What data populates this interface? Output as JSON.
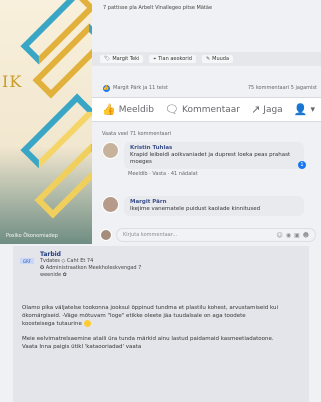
{
  "art": {
    "logo_text": "IK",
    "caption": "Poslko Ökonomiadep"
  },
  "top_card": {
    "description": "7 pattisse pla Arbelt Vinallegeo pitse Mätäe"
  },
  "action_pills": [
    {
      "icon": "tag-icon",
      "label": "Margit Teki"
    },
    {
      "icon": "location-icon",
      "label": "Tian aeokorid"
    },
    {
      "icon": "pencil-icon",
      "label": "Muuda"
    }
  ],
  "stats": {
    "reactions": "Margit Pärk ja 11 teist",
    "comments": "75 kommentaari  5 jagamist"
  },
  "fb_actions": [
    {
      "icon": "like-icon",
      "label": "Meeldib"
    },
    {
      "icon": "comment-icon",
      "label": "Kommentaar"
    },
    {
      "icon": "share-icon",
      "label": "Jaga"
    }
  ],
  "sort_label": "Vaata veel 71 kommentaari",
  "comments": [
    {
      "name": "Kristin Tuhlas",
      "text": "Krapid leibeidi aoikvaniadet ja duprest loeka peas prahast moeges",
      "meta": "Meeldib · Vasta · 41 nädalat",
      "badge": "1"
    },
    {
      "name": "Margit Pärn",
      "text": "Ikejime vanematele puidust kaolade kinnitused",
      "meta": ""
    }
  ],
  "write_comment": {
    "placeholder": "Kirjuta kommentaar..."
  },
  "post": {
    "badge": "GRF",
    "author": "Tarbid",
    "subline1": "Tvdates ◇ Caht Et 74",
    "subline2": "✪ Administraatkon  Meekholeskvengad 7",
    "subline3": "weenide  ✿",
    "paragraph1": "Olamo pika väljatelse tookonna jooksul õppinud tundma et plastilu kohest, arvustamiseid kui ökomärgiseid. -Väge mõtuvam \"loge\" etikke oleete jäa tuudalsale on aga toodete koosteisega tutaurine",
    "paragraph2": "Meie eelvimatrelsaemine ataili üra tunda märkid ainu lastud paidamaid kasmeetiadatoone. Vaata Inna paigis ütikl 'kataooriadad' vaata"
  }
}
